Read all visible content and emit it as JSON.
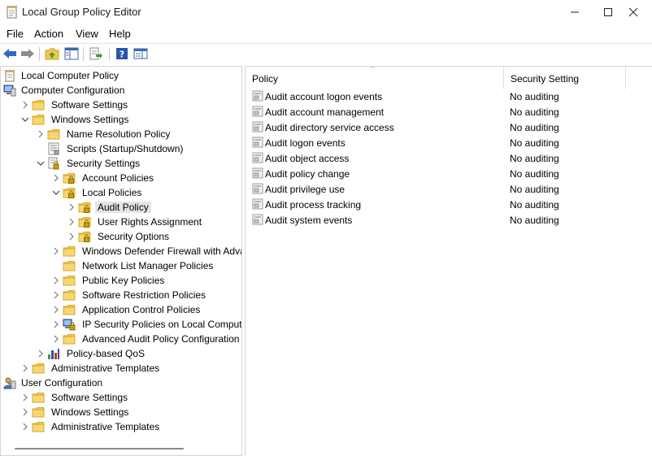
{
  "window": {
    "title": "Local Group Policy Editor"
  },
  "menu": [
    "File",
    "Action",
    "View",
    "Help"
  ],
  "toolbar": [
    "back-icon",
    "forward-icon",
    "up-folder-icon",
    "show-hide-tree-icon",
    "export-list-icon",
    "help-icon",
    "properties-pane-icon"
  ],
  "tree": [
    {
      "label": "Local Computer Policy",
      "level": 0,
      "expander": "none",
      "icon": "policy-doc-icon"
    },
    {
      "label": "Computer Configuration",
      "level": 0,
      "expander": "expanded",
      "icon": "computer-icon"
    },
    {
      "label": "Software Settings",
      "level": 1,
      "expander": "collapsed",
      "icon": "folder-icon"
    },
    {
      "label": "Windows Settings",
      "level": 1,
      "expander": "expanded",
      "icon": "folder-icon"
    },
    {
      "label": "Name Resolution Policy",
      "level": 2,
      "expander": "collapsed",
      "icon": "folder-icon"
    },
    {
      "label": "Scripts (Startup/Shutdown)",
      "level": 2,
      "expander": "none",
      "icon": "scripts-icon"
    },
    {
      "label": "Security Settings",
      "level": 2,
      "expander": "expanded",
      "icon": "security-settings-icon"
    },
    {
      "label": "Account Policies",
      "level": 3,
      "expander": "collapsed",
      "icon": "locked-folder-icon"
    },
    {
      "label": "Local Policies",
      "level": 3,
      "expander": "expanded",
      "icon": "locked-folder-icon"
    },
    {
      "label": "Audit Policy",
      "level": 4,
      "expander": "collapsed",
      "icon": "locked-folder-icon",
      "selected": true
    },
    {
      "label": "User Rights Assignment",
      "level": 4,
      "expander": "collapsed",
      "icon": "locked-folder-icon"
    },
    {
      "label": "Security Options",
      "level": 4,
      "expander": "collapsed",
      "icon": "locked-folder-icon"
    },
    {
      "label": "Windows Defender Firewall with Adva",
      "level": 3,
      "expander": "collapsed",
      "icon": "folder-icon"
    },
    {
      "label": "Network List Manager Policies",
      "level": 3,
      "expander": "none",
      "icon": "folder-icon"
    },
    {
      "label": "Public Key Policies",
      "level": 3,
      "expander": "collapsed",
      "icon": "folder-icon"
    },
    {
      "label": "Software Restriction Policies",
      "level": 3,
      "expander": "collapsed",
      "icon": "folder-icon"
    },
    {
      "label": "Application Control Policies",
      "level": 3,
      "expander": "collapsed",
      "icon": "folder-icon"
    },
    {
      "label": "IP Security Policies on Local Compute",
      "level": 3,
      "expander": "collapsed",
      "icon": "ip-security-icon"
    },
    {
      "label": "Advanced Audit Policy Configuration",
      "level": 3,
      "expander": "collapsed",
      "icon": "folder-icon"
    },
    {
      "label": "Policy-based QoS",
      "level": 2,
      "expander": "collapsed",
      "icon": "qos-chart-icon"
    },
    {
      "label": "Administrative Templates",
      "level": 1,
      "expander": "collapsed",
      "icon": "folder-icon"
    },
    {
      "label": "User Configuration",
      "level": 0,
      "expander": "expanded",
      "icon": "user-icon"
    },
    {
      "label": "Software Settings",
      "level": 1,
      "expander": "collapsed",
      "icon": "folder-icon"
    },
    {
      "label": "Windows Settings",
      "level": 1,
      "expander": "collapsed",
      "icon": "folder-icon"
    },
    {
      "label": "Administrative Templates",
      "level": 1,
      "expander": "collapsed",
      "icon": "folder-icon"
    }
  ],
  "list": {
    "columns": [
      "Policy",
      "Security Setting"
    ],
    "rows": [
      {
        "policy": "Audit account logon events",
        "setting": "No auditing"
      },
      {
        "policy": "Audit account management",
        "setting": "No auditing"
      },
      {
        "policy": "Audit directory service access",
        "setting": "No auditing"
      },
      {
        "policy": "Audit logon events",
        "setting": "No auditing"
      },
      {
        "policy": "Audit object access",
        "setting": "No auditing"
      },
      {
        "policy": "Audit policy change",
        "setting": "No auditing"
      },
      {
        "policy": "Audit privilege use",
        "setting": "No auditing"
      },
      {
        "policy": "Audit process tracking",
        "setting": "No auditing"
      },
      {
        "policy": "Audit system events",
        "setting": "No auditing"
      }
    ]
  },
  "colors": {
    "folder": "#f2c94c",
    "folder_dark": "#d9a92b",
    "selection": "#e5e5e5",
    "toolbar_blue": "#2b6cc4",
    "toolbar_green": "#3f9a3a"
  }
}
